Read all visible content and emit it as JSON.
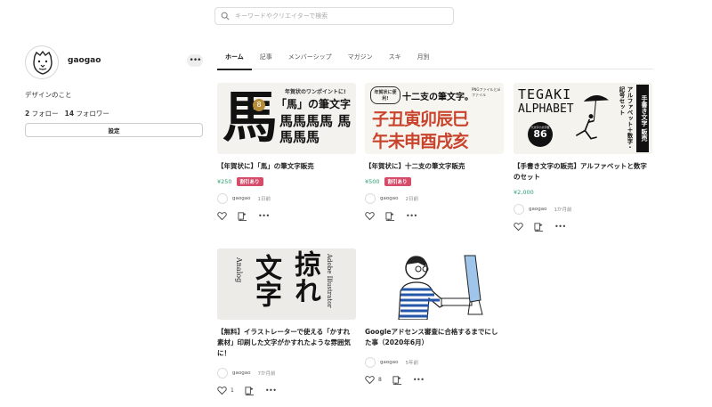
{
  "search": {
    "placeholder": "キーワードやクリエイターで検索"
  },
  "profile": {
    "username": "gaogao",
    "bio": "デザインのこと",
    "follow_count": "2",
    "follow_label": "フォロー",
    "follower_count": "14",
    "follower_label": "フォロワー",
    "settings_label": "設定",
    "more_label": "•••"
  },
  "tabs": [
    "ホーム",
    "記事",
    "メンバーシップ",
    "マガジン",
    "スキ",
    "月別"
  ],
  "cards": [
    {
      "title": "【年賀状に】「馬」の筆文字販売",
      "price": "¥250",
      "badge": "割引あり",
      "author": "gaogao",
      "time": "1日前",
      "likes": "",
      "thumb_text": {
        "tagline": "年賀状のワンポイントに!",
        "heading": "「馬」の筆文字",
        "big": "馬",
        "badge_num": "8",
        "chars": "馬馬馬馬 馬馬馬馬"
      }
    },
    {
      "title": "【年賀状に】十二支の筆文字販売",
      "price": "¥500",
      "badge": "割引あり",
      "author": "gaogao",
      "time": "2日前",
      "likes": "",
      "thumb_text": {
        "tagline": "年賀状に便利!",
        "heading": "十二支の筆文字。",
        "note": "PNGファイルとaiファイル",
        "row1": "子丑寅卯辰巳",
        "row2": "午未申酉戌亥"
      }
    },
    {
      "title": "【手書き文字の販売】アルファベットと数字のセット",
      "price": "¥2,000",
      "badge": "",
      "author": "gaogao",
      "time": "1か月前",
      "likes": "",
      "thumb_text": {
        "line1": "TEGAKI",
        "line2": "ALPHABET",
        "seal": "86",
        "seal_top": "大文字小文字数",
        "vertical1": "手書き文字 販売",
        "vertical2": "アルファベット＋数字・記号セット"
      }
    },
    {
      "title": "【無料】イラストレーターで使える「かすれ素材」印刷した文字がかすれたような雰囲気に！",
      "price": "",
      "badge": "",
      "author": "gaogao",
      "time": "7か月前",
      "likes": "1",
      "thumb_text": {
        "big1": "文字",
        "big2": "掠れ",
        "side1": "Analog",
        "side2": "Adobe Illustrator"
      }
    },
    {
      "title": "Googleアドセンス審査に合格するまでにした事（2020年6月）",
      "price": "",
      "badge": "",
      "author": "gaogao",
      "time": "5年前",
      "likes": "8",
      "thumb_text": {}
    }
  ],
  "colors": {
    "price": "#2a9d6f",
    "badge": "#d64a6a",
    "tab_active": "#222222"
  }
}
